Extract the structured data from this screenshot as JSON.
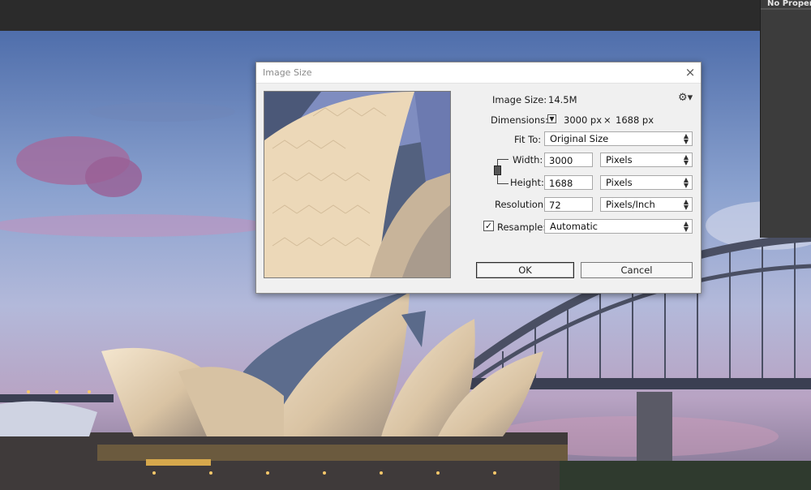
{
  "app": {
    "properties_panel_title": "No Properties"
  },
  "dialog": {
    "title": "Image Size",
    "close_label": "×",
    "image_size_label": "Image Size:",
    "image_size_value": "14.5M",
    "dimensions_label": "Dimensions:",
    "dimensions_width": "3000 px",
    "dimensions_x": "×",
    "dimensions_height": "1688 px",
    "fit_to_label": "Fit To:",
    "fit_to_value": "Original Size",
    "width_label": "Width:",
    "width_value": "3000",
    "width_unit": "Pixels",
    "height_label": "Height:",
    "height_value": "1688",
    "height_unit": "Pixels",
    "resolution_label": "Resolution:",
    "resolution_value": "72",
    "resolution_unit": "Pixels/Inch",
    "resample_label": "Resample:",
    "resample_checked": true,
    "resample_value": "Automatic",
    "ok_label": "OK",
    "cancel_label": "Cancel"
  },
  "icons": {
    "gear": "gear-icon",
    "dimensions_dropdown": "dropdown-triangle-icon",
    "constrain": "chain-link-icon",
    "close": "close-icon"
  },
  "colors": {
    "dialog_bg": "#f0f0f0",
    "app_bar": "#2b2b2b",
    "panel": "#3c3c3c"
  }
}
